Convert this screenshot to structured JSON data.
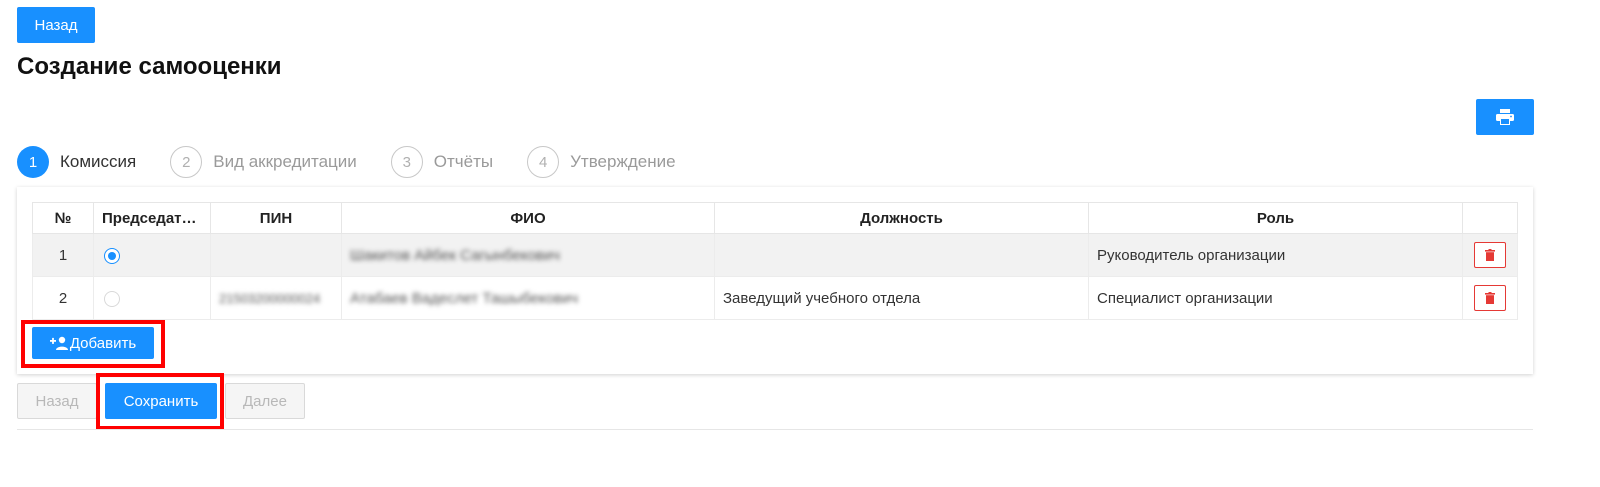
{
  "header": {
    "back_label": "Назад",
    "title": "Создание самооценки"
  },
  "toolbar": {
    "print_icon": "printer-icon"
  },
  "steps": [
    {
      "number": "1",
      "label": "Комиссия",
      "state": "active"
    },
    {
      "number": "2",
      "label": "Вид аккредитации",
      "state": "inactive"
    },
    {
      "number": "3",
      "label": "Отчёты",
      "state": "inactive"
    },
    {
      "number": "4",
      "label": "Утверждение",
      "state": "inactive"
    }
  ],
  "table": {
    "columns": [
      "№",
      "Председате…",
      "ПИН",
      "ФИО",
      "Должность",
      "Роль",
      ""
    ],
    "rows": [
      {
        "num": "1",
        "chair": true,
        "pin": "",
        "fio": "Шакитов Айбек Сагынбекович",
        "position": "",
        "role": "Руководитель организации"
      },
      {
        "num": "2",
        "chair": false,
        "pin": "21503200000024",
        "fio": "Атабаев Вадеслет Ташыбекович",
        "position": "Заведущий учебного отдела",
        "role": "Специалист организации"
      }
    ]
  },
  "add_button_label": "Добавить",
  "footer": {
    "back_label": "Назад",
    "save_label": "Сохранить",
    "next_label": "Далее"
  },
  "colors": {
    "primary": "#1890ff",
    "danger": "#e53935",
    "highlight": "#ff0000"
  }
}
